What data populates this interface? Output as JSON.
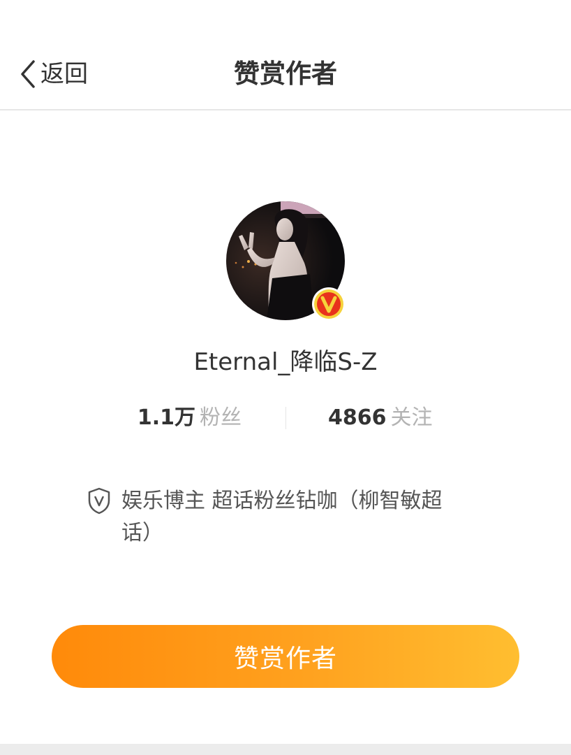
{
  "header": {
    "back_label": "返回",
    "title": "赞赏作者",
    "back_icon": "chevron-left-icon"
  },
  "profile": {
    "username": "Eternal_降临S-Z",
    "verified_icon": "verified-v-badge-icon",
    "stats": {
      "followers_value": "1.1万",
      "followers_label": "粉丝",
      "following_value": "4866",
      "following_label": "关注"
    },
    "verification": {
      "icon": "shield-v-icon",
      "text": "娱乐博主 超话粉丝钻咖（柳智敏超话）"
    }
  },
  "cta": {
    "label": "赞赏作者"
  },
  "colors": {
    "accent_start": "#ff8a0a",
    "accent_end": "#ffbe30",
    "badge_red": "#e8321c",
    "badge_gold": "#f6d23b",
    "text_primary": "#333333",
    "text_muted": "#b3b3b3"
  }
}
